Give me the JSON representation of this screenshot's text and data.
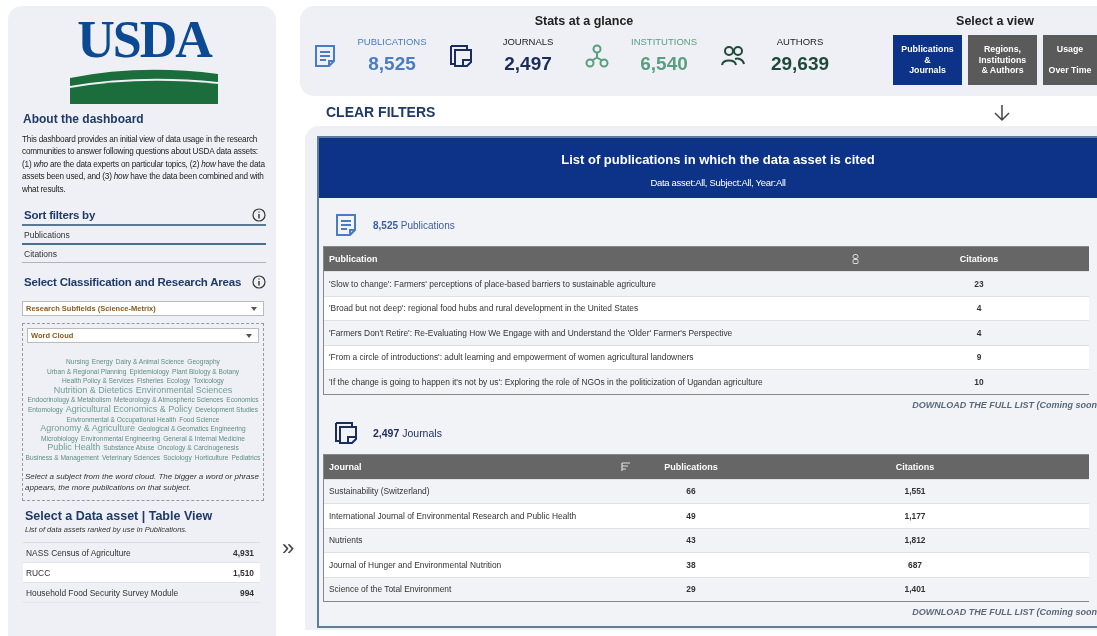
{
  "logo": {
    "text": "USDA"
  },
  "about": {
    "title": "About the dashboard",
    "text": "This dashboard provides an initial view of data usage in the research communities to answer following questions about USDA data assets: (1) *who* are the data experts on particular topics, (2) *how* have the data assets been used, and (3) *how* have the data been combined and with what results."
  },
  "sort_filters": {
    "title": "Sort filters by",
    "options": [
      {
        "label": "Publications",
        "selected": true
      },
      {
        "label": "Citations",
        "selected": false
      }
    ]
  },
  "classification": {
    "title": "Select Classification and Research Areas",
    "dropdown": "Research Subfields (Science-Metrix)",
    "view_dropdown": "Word Cloud",
    "word_cloud": [
      [
        {
          "text": "Nursing",
          "kind": "small"
        },
        {
          "text": "Energy",
          "kind": "small"
        }
      ],
      [
        {
          "text": "Dairy & Animal Science",
          "kind": "small"
        }
      ],
      [
        {
          "text": "Geography",
          "kind": "small"
        },
        {
          "text": "Urban & Regional Planning",
          "kind": "small"
        },
        {
          "text": "Epidemiology",
          "kind": "small"
        }
      ],
      [
        {
          "text": "Plant Biology & Botany",
          "kind": "small"
        },
        {
          "text": "Health Policy & Services",
          "kind": "small"
        },
        {
          "text": "Fisheries",
          "kind": "small"
        }
      ],
      [
        {
          "text": "Ecology",
          "kind": "small"
        },
        {
          "text": "Toxicology",
          "kind": "small"
        },
        {
          "text": "Nutrition & Dietetics",
          "kind": "medium"
        },
        {
          "text": "Environmental Sciences",
          "kind": "medium"
        }
      ],
      [
        {
          "text": "Endocrinology & Metabolism",
          "kind": "small"
        },
        {
          "text": "Meteorology & Atmospheric Sciences",
          "kind": "small"
        },
        {
          "text": "Economics",
          "kind": "small"
        }
      ],
      [
        {
          "text": "Entomology",
          "kind": "small"
        },
        {
          "text": "Agricultural Economics & Policy",
          "kind": "medium"
        },
        {
          "text": "Development Studies",
          "kind": "small"
        }
      ],
      [
        {
          "text": "Environmental & Occupational Health",
          "kind": "small"
        },
        {
          "text": "Food Science",
          "kind": "small"
        },
        {
          "text": "Agronomy & Agriculture",
          "kind": "medium"
        }
      ],
      [
        {
          "text": "Geological & Geomatics Engineering",
          "kind": "small"
        },
        {
          "text": "Microbiology",
          "kind": "small"
        },
        {
          "text": "Environmental Engineering",
          "kind": "small"
        }
      ],
      [
        {
          "text": "General & Internal Medicine",
          "kind": "small"
        },
        {
          "text": "Public Health",
          "kind": "medium"
        },
        {
          "text": "Substance Abuse",
          "kind": "small"
        }
      ],
      [
        {
          "text": "Oncology & Carcinogenesis",
          "kind": "small"
        }
      ],
      [
        {
          "text": "Business & Management",
          "kind": "small"
        },
        {
          "text": "Veterinary Sciences",
          "kind": "small"
        },
        {
          "text": "Sociology",
          "kind": "small"
        }
      ],
      [
        {
          "text": "Horticulture",
          "kind": "small"
        },
        {
          "text": "Pediatrics",
          "kind": "small"
        }
      ]
    ],
    "hint": "Select a subject from the word cloud. The bigger a word or phrase appears, the more publications on that subject."
  },
  "data_assets": {
    "title": "Select a Data asset | Table View",
    "subtitle": "List of data assets ranked by use in Publications.",
    "rows": [
      {
        "name": "NASS Census of Agriculture",
        "count": "4,931",
        "selected": false
      },
      {
        "name": "RUCC",
        "count": "1,510",
        "selected": true
      },
      {
        "name": "Household Food Security Survey Module",
        "count": "994",
        "selected": false
      }
    ]
  },
  "expand_arrow": "»",
  "stats": {
    "title": "Stats at a glance",
    "items": [
      {
        "kind": "publications",
        "label": "PUBLICATIONS",
        "value": "8,525",
        "color": "#4a7cc4"
      },
      {
        "kind": "journals",
        "label": "JOURNALS",
        "value": "2,497",
        "color": "#1b2d5c"
      },
      {
        "kind": "institutions",
        "label": "INSTITUTIONS",
        "value": "6,540",
        "color": "#5a9e80"
      },
      {
        "kind": "authors",
        "label": "AUTHORS",
        "value": "29,639",
        "color": "#1f4a38"
      }
    ]
  },
  "views": {
    "title": "Select a view",
    "buttons": [
      {
        "label": "Publications\n&\nJournals",
        "selected": true
      },
      {
        "label": "Regions,\nInstitutions\n& Authors",
        "selected": false
      },
      {
        "label": "Usage\n\nOver Time",
        "selected": false
      }
    ]
  },
  "clear_filters": "CLEAR FILTERS",
  "publications": {
    "title": "List of publications in which the data asset is cited",
    "subtitle": "Data asset:All, Subject:All, Year:All",
    "count": "**8,525** Publications",
    "columns": [
      "Publication",
      "Citations"
    ],
    "rows": [
      [
        "'Slow to change': Farmers' perceptions of place-based barriers to sustainable agriculture",
        "23"
      ],
      [
        "'Broad but not deep': regional food hubs and rural development in the United States",
        "4"
      ],
      [
        "'Farmers Don't Retire': Re-Evaluating How We Engage with and Understand the 'Older' Farmer's Perspective",
        "4"
      ],
      [
        "'From a circle of introductions': adult learning and empowerment of women agricultural landowners",
        "9"
      ],
      [
        "'If the change is going to happen it's not by us': Exploring the role of NGOs in the politicization of Ugandan agriculture",
        "10"
      ]
    ],
    "download": "DOWNLOAD THE FULL LIST (Coming soon"
  },
  "journals": {
    "count": "**2,497** Journals",
    "columns": [
      "Journal",
      "Publications",
      "Citations"
    ],
    "rows": [
      [
        "Sustainability (Switzerland)",
        "66",
        "1,551"
      ],
      [
        "International Journal of Environmental Research and Public Health",
        "49",
        "1,177"
      ],
      [
        "Nutrients",
        "43",
        "1,812"
      ],
      [
        "Journal of Hunger and Environmental Nutrition",
        "38",
        "687"
      ],
      [
        "Science of the Total Environment",
        "29",
        "1,401"
      ]
    ],
    "download": "DOWNLOAD THE FULL LIST (Coming soon"
  }
}
